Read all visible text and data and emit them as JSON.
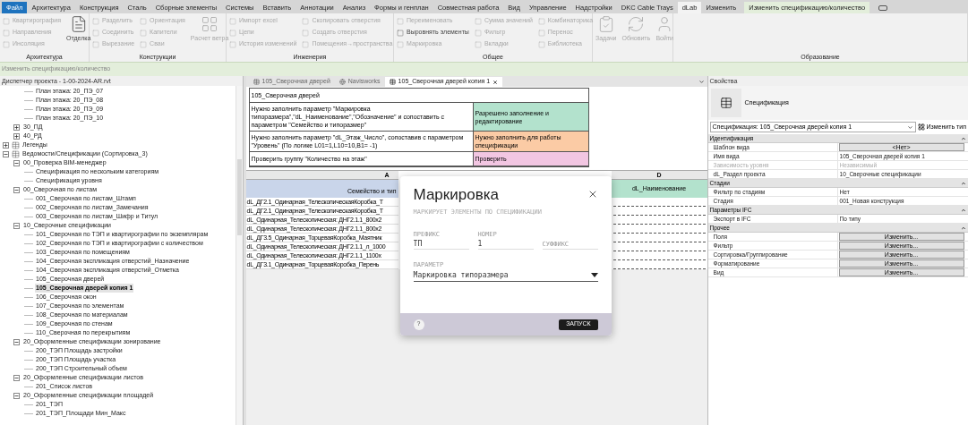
{
  "ribbon_tabs": [
    {
      "label": "Файл",
      "kind": "file",
      "selected": false
    },
    {
      "label": "Архитектура",
      "kind": "normal",
      "selected": false
    },
    {
      "label": "Конструкция",
      "kind": "normal",
      "selected": false
    },
    {
      "label": "Сталь",
      "kind": "normal",
      "selected": false
    },
    {
      "label": "Сборные элементы",
      "kind": "normal",
      "selected": false
    },
    {
      "label": "Системы",
      "kind": "normal",
      "selected": false
    },
    {
      "label": "Вставить",
      "kind": "normal",
      "selected": false
    },
    {
      "label": "Аннотации",
      "kind": "normal",
      "selected": false
    },
    {
      "label": "Анализ",
      "kind": "normal",
      "selected": false
    },
    {
      "label": "Формы и генплан",
      "kind": "normal",
      "selected": false
    },
    {
      "label": "Совместная работа",
      "kind": "normal",
      "selected": false
    },
    {
      "label": "Вид",
      "kind": "normal",
      "selected": false
    },
    {
      "label": "Управление",
      "kind": "normal",
      "selected": false
    },
    {
      "label": "Надстройки",
      "kind": "normal",
      "selected": false
    },
    {
      "label": "DKC Cable Trays",
      "kind": "normal",
      "selected": false
    },
    {
      "label": "dLab",
      "kind": "normal",
      "selected": true
    },
    {
      "label": "Изменить",
      "kind": "normal",
      "selected": false
    },
    {
      "label": "Изменить спецификацию/количество",
      "kind": "context",
      "selected": false
    }
  ],
  "ribbon_groups": [
    {
      "label": "Архитектура",
      "columns": [
        {
          "kind": "stack",
          "items": [
            {
              "label": "Квартирография",
              "disabled": true
            },
            {
              "label": "Направления",
              "disabled": true
            },
            {
              "label": "Инсоляция",
              "disabled": true
            }
          ]
        },
        {
          "kind": "large",
          "items": [
            {
              "label": "Отделка",
              "disabled": false
            }
          ]
        }
      ]
    },
    {
      "label": "Конструкции",
      "columns": [
        {
          "kind": "stack",
          "items": [
            {
              "label": "Разделить",
              "disabled": true
            },
            {
              "label": "Соединить",
              "disabled": true
            },
            {
              "label": "Вырезание",
              "disabled": true
            }
          ]
        },
        {
          "kind": "stack",
          "items": [
            {
              "label": "Ориентация",
              "disabled": true
            },
            {
              "label": "Капители",
              "disabled": true
            },
            {
              "label": "Сваи",
              "disabled": true
            }
          ]
        },
        {
          "kind": "large",
          "items": [
            {
              "label": "Расчет ветра",
              "disabled": true
            }
          ]
        }
      ]
    },
    {
      "label": "Инженерия",
      "columns": [
        {
          "kind": "stack",
          "items": [
            {
              "label": "Импорт excel",
              "disabled": true
            },
            {
              "label": "Цепи",
              "disabled": true
            },
            {
              "label": "История изменений",
              "disabled": true
            }
          ]
        },
        {
          "kind": "stack",
          "items": [
            {
              "label": "Скопировать отверстия",
              "disabled": true
            },
            {
              "label": "Создать отверстия",
              "disabled": true
            },
            {
              "label": "Помещения→пространства",
              "disabled": true
            }
          ]
        }
      ]
    },
    {
      "label": "Общее",
      "columns": [
        {
          "kind": "stack",
          "items": [
            {
              "label": "Переименовать",
              "disabled": true
            },
            {
              "label": "Выровнять элементы",
              "disabled": false
            },
            {
              "label": "Маркировка",
              "disabled": true
            }
          ]
        },
        {
          "kind": "stack",
          "items": [
            {
              "label": "Сумма значений",
              "disabled": true
            },
            {
              "label": "Фильтр",
              "disabled": true
            },
            {
              "label": "Вкладки",
              "disabled": true
            }
          ]
        },
        {
          "kind": "stack",
          "items": [
            {
              "label": "Комбинаторика",
              "disabled": true
            },
            {
              "label": "Перенос",
              "disabled": true
            },
            {
              "label": "Библиотека",
              "disabled": true
            }
          ]
        }
      ]
    },
    {
      "columns": [
        {
          "kind": "large",
          "items": [
            {
              "label": "Задачи",
              "disabled": true
            }
          ]
        },
        {
          "kind": "large",
          "items": [
            {
              "label": "Обновить",
              "disabled": true
            }
          ]
        },
        {
          "kind": "large",
          "items": [
            {
              "label": "Войти",
              "disabled": true
            }
          ]
        }
      ]
    },
    {
      "label": "Образование"
    }
  ],
  "options_bar": "Изменить спецификацию/количество",
  "project_browser": {
    "title": "Диспетчер проекта - 1-00-2024-AR.rvt",
    "tree": [
      {
        "children": [
          {
            "children": [
              {
                "label": "План этажа: 20_ПЭ_07",
                "selected": false
              },
              {
                "label": "План этажа: 20_ПЭ_08",
                "selected": false
              },
              {
                "label": "План этажа: 20_ПЭ_09",
                "selected": false
              },
              {
                "label": "План этажа: 20_ПЭ_10",
                "selected": false
              }
            ]
          },
          {
            "label": "30_ПД",
            "expanded": false,
            "selected": false
          },
          {
            "label": "40_РД",
            "expanded": false,
            "selected": false
          }
        ]
      },
      {
        "kind": "category",
        "label": "Легенды",
        "expanded": false,
        "selected": false
      },
      {
        "kind": "category",
        "label": "Ведомости/Спецификации (Сортировка_3)",
        "expanded": true,
        "selected": false,
        "children": [
          {
            "label": "00_Проверка BIM-менеджер",
            "expanded": true,
            "selected": false,
            "children": [
              {
                "label": "Спецификация по нескольким категориям",
                "selected": false
              },
              {
                "label": "Спецификация уровня",
                "selected": false
              }
            ]
          },
          {
            "label": "00_Сверочная по листам",
            "expanded": true,
            "selected": false,
            "children": [
              {
                "label": "001_Сверочная по листам_Штамп",
                "selected": false
              },
              {
                "label": "002_Сверочная по листам_Замечания",
                "selected": false
              },
              {
                "label": "003_Сверочная по листам_Шифр и Титул",
                "selected": false
              }
            ]
          },
          {
            "label": "10_Сверочные спецификации",
            "expanded": true,
            "selected": false,
            "children": [
              {
                "label": "101_Сверочная по ТЭП и квартирографии по экземплярам",
                "selected": false
              },
              {
                "label": "102_Сверочная по ТЭП и квартирографии с количеством",
                "selected": false
              },
              {
                "label": "103_Сверочная по помещениям",
                "selected": false
              },
              {
                "label": "104_Сверочная экспликация отверстий_Назначение",
                "selected": false
              },
              {
                "label": "104_Сверочная экспликация отверстий_Отметка",
                "selected": false
              },
              {
                "label": "105_Сверочная дверей",
                "selected": false
              },
              {
                "label": "105_Сверочная дверей копия 1",
                "selected": true
              },
              {
                "label": "106_Сверочная окон",
                "selected": false
              },
              {
                "label": "107_Сверочная по элементам",
                "selected": false
              },
              {
                "label": "108_Сверочная по материалам",
                "selected": false
              },
              {
                "label": "109_Сверочная по стенам",
                "selected": false
              },
              {
                "label": "110_Сверочная по перекрытиям",
                "selected": false
              }
            ]
          },
          {
            "label": "20_Оформленные спецификации зонирование",
            "expanded": true,
            "selected": false,
            "children": [
              {
                "label": "200_ТЭП Площадь застройки",
                "selected": false
              },
              {
                "label": "200_ТЭП Площадь участка",
                "selected": false
              },
              {
                "label": "200_ТЭП Строительный объем",
                "selected": false
              }
            ]
          },
          {
            "label": "20_Оформленные спецификации листов",
            "expanded": true,
            "selected": false,
            "children": [
              {
                "label": "201_Список листов",
                "selected": false
              }
            ]
          },
          {
            "label": "20_Оформленные спецификации площадей",
            "expanded": true,
            "selected": false,
            "children": [
              {
                "label": "201_ТЭП",
                "selected": false
              },
              {
                "label": "201_ТЭП_Площади Мин_Макс",
                "selected": false
              }
            ]
          }
        ]
      }
    ]
  },
  "view_tabs": [
    {
      "label": "105_Сверочная дверей",
      "kind": "table",
      "selected": false
    },
    {
      "label": "Navisworks",
      "kind": "globe",
      "selected": false
    },
    {
      "label": "105_Сверочная дверей копия 1",
      "kind": "table",
      "selected": true
    }
  ],
  "schedule": {
    "title": "105_Сверочная дверей",
    "notes": [
      {
        "text": "Нужно заполнить параметр \"Маркировка типоразмера\",\"dL_Наименование\",\"Обозначение\" и сопоставить с параметром \"Семейство и типоразмер\"",
        "legend": "Разрешено заполнение и редактирование",
        "color": "#b3e2cd"
      },
      {
        "text": "Нужно заполнить параметр \"dL_Этаж_Число\", сопоставив с параметром \"Уровень\" (По логике L01=1,L10=10,B1= -1)",
        "legend": "Нужно заполнить для работы спецификации",
        "color": "#fbcba5"
      },
      {
        "text": "Проверить группу \"Количество на этаж\"",
        "legend": "Проверить",
        "color": "#f2c6e2"
      }
    ],
    "columns": [
      {
        "letter": "A",
        "header": "Семейство и тип",
        "color": "#c9d5ea"
      },
      {
        "letter": "D",
        "header": "dL_Наименование",
        "color": "#b3e2cd"
      }
    ],
    "rows": [
      "dL_ДГ2.1_Одинарная_ТелескопическаяКоробка_Т",
      "dL_ДГ2.1_Одинарная_ТелескопическаяКоробка_Т",
      "dL_Одинарная_Телескопическая: ДНГ2.1.1_800х2",
      "dL_Одинарная_Телескопическая: ДНГ2.1.1_800х2",
      "dL_ДГ3.5_Одинарная_ТорцеваяКоробка_Маятник",
      "dL_Одинарная_Телескопическая: ДНГ2.1.1_л_1000",
      "dL_Одинарная_Телескопическая: ДНГ2.1.1_1100х",
      "dL_ДГ3.1_Одинарная_ТорцеваяКоробка_Перень"
    ]
  },
  "dialog": {
    "title": "Маркировка",
    "subtitle": "МАРКИРУЕТ ЭЛЕМЕНТЫ ПО СПЕЦИФИКАЦИИ",
    "fields": [
      {
        "label": "ПРЕФИКС",
        "value": "ТП"
      },
      {
        "label": "НОМЕР",
        "value": "1"
      },
      {
        "placeholder": "СУФФИКС"
      }
    ],
    "parameter": {
      "label": "ПАРАМЕТР",
      "value": "Маркировка типоразмера"
    },
    "help": "?",
    "run_button": "ЗАПУСК"
  },
  "properties": {
    "title": "Свойства",
    "type_name": "Спецификация",
    "type_selector": "Спецификация: 105_Сверочная дверей копия 1",
    "edit_type_button": "Изменить тип",
    "sections": [
      {
        "title": "Идентификация",
        "expanded": true,
        "rows": [
          {
            "name": "Шаблон вида",
            "value": "<Нет>",
            "kind": "button",
            "disabled": false
          },
          {
            "name": "Имя вида",
            "value": "105_Сверочная дверей копия 1",
            "kind": "text",
            "disabled": false
          },
          {
            "name": "Зависимость уровня",
            "value": "Независимый",
            "kind": "text",
            "disabled": true
          },
          {
            "name": "dL_Раздел проекта",
            "value": "10_Сверочные спецификации",
            "kind": "text",
            "disabled": false
          }
        ]
      },
      {
        "title": "Стадии",
        "expanded": true,
        "rows": [
          {
            "name": "Фильтр по стадиям",
            "value": "Нет",
            "kind": "text",
            "disabled": false
          },
          {
            "name": "Стадия",
            "value": "001_Новая конструкция",
            "kind": "text",
            "disabled": false
          }
        ]
      },
      {
        "title": "Параметры IFC",
        "expanded": true,
        "rows": [
          {
            "name": "Экспорт в IFC",
            "value": "По типу",
            "kind": "text",
            "disabled": false
          }
        ]
      },
      {
        "title": "Прочее",
        "expanded": true,
        "rows": [
          {
            "name": "Поля",
            "value": "Изменить...",
            "kind": "button",
            "disabled": false
          },
          {
            "name": "Фильтр",
            "value": "Изменить...",
            "kind": "button",
            "disabled": false
          },
          {
            "name": "Сортировка/Группирование",
            "value": "Изменить...",
            "kind": "button",
            "disabled": false
          },
          {
            "name": "Форматирование",
            "value": "Изменить...",
            "kind": "button",
            "disabled": false
          },
          {
            "name": "Вид",
            "value": "Изменить...",
            "kind": "button",
            "disabled": false
          }
        ]
      }
    ]
  }
}
